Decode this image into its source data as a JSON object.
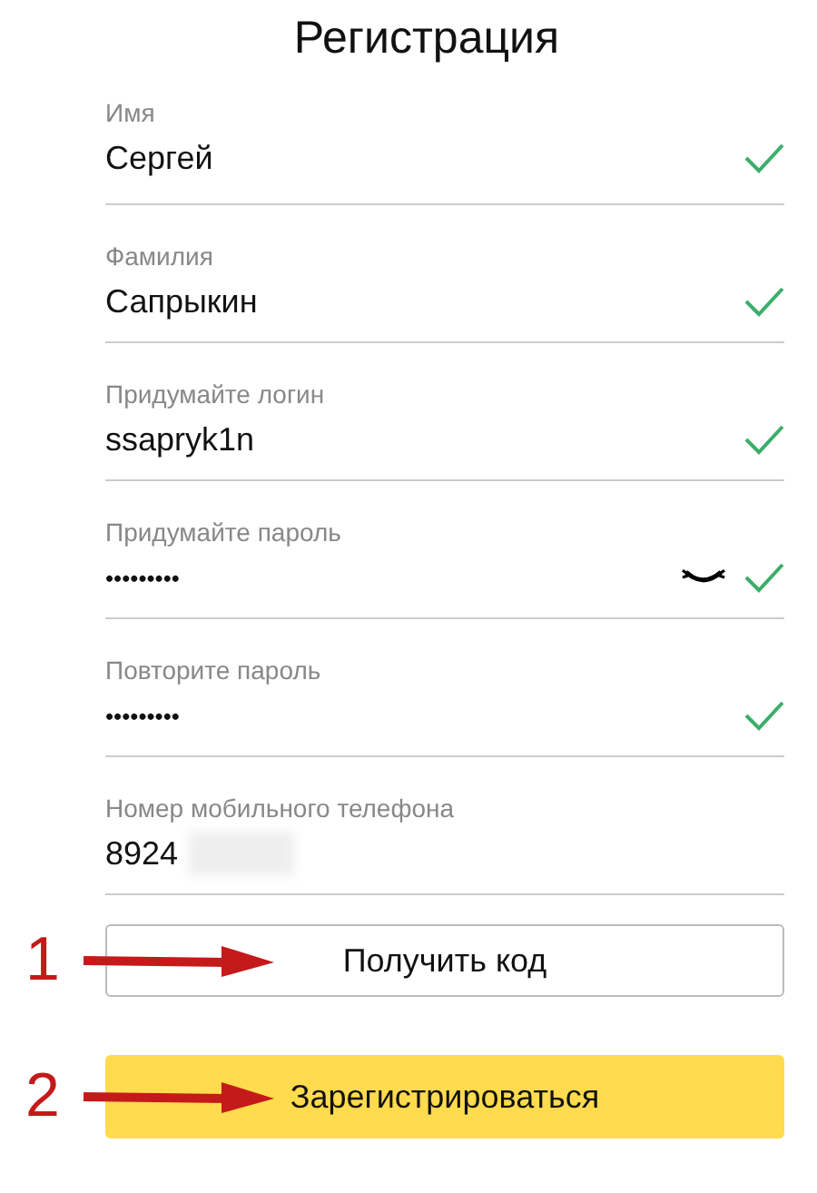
{
  "title": "Регистрация",
  "fields": [
    {
      "label": "Имя",
      "value": "Сергей",
      "valid": true
    },
    {
      "label": "Фамилия",
      "value": "Сапрыкин",
      "valid": true
    },
    {
      "label": "Придумайте логин",
      "value": "ssapryk1n",
      "valid": true
    },
    {
      "label": "Придумайте пароль",
      "value": "•••••••••",
      "valid": true,
      "toggle": {
        "revealed": false
      }
    },
    {
      "label": "Повторите пароль",
      "value": "•••••••••",
      "valid": true
    },
    {
      "label": "Номер мобильного телефона",
      "value": "8924",
      "valid": false,
      "redacted": true
    }
  ],
  "buttons": [
    {
      "label": "Получить код",
      "kind": "secondary",
      "marker": "1"
    },
    {
      "label": "Зарегистрироваться",
      "kind": "primary",
      "marker": "2"
    }
  ]
}
